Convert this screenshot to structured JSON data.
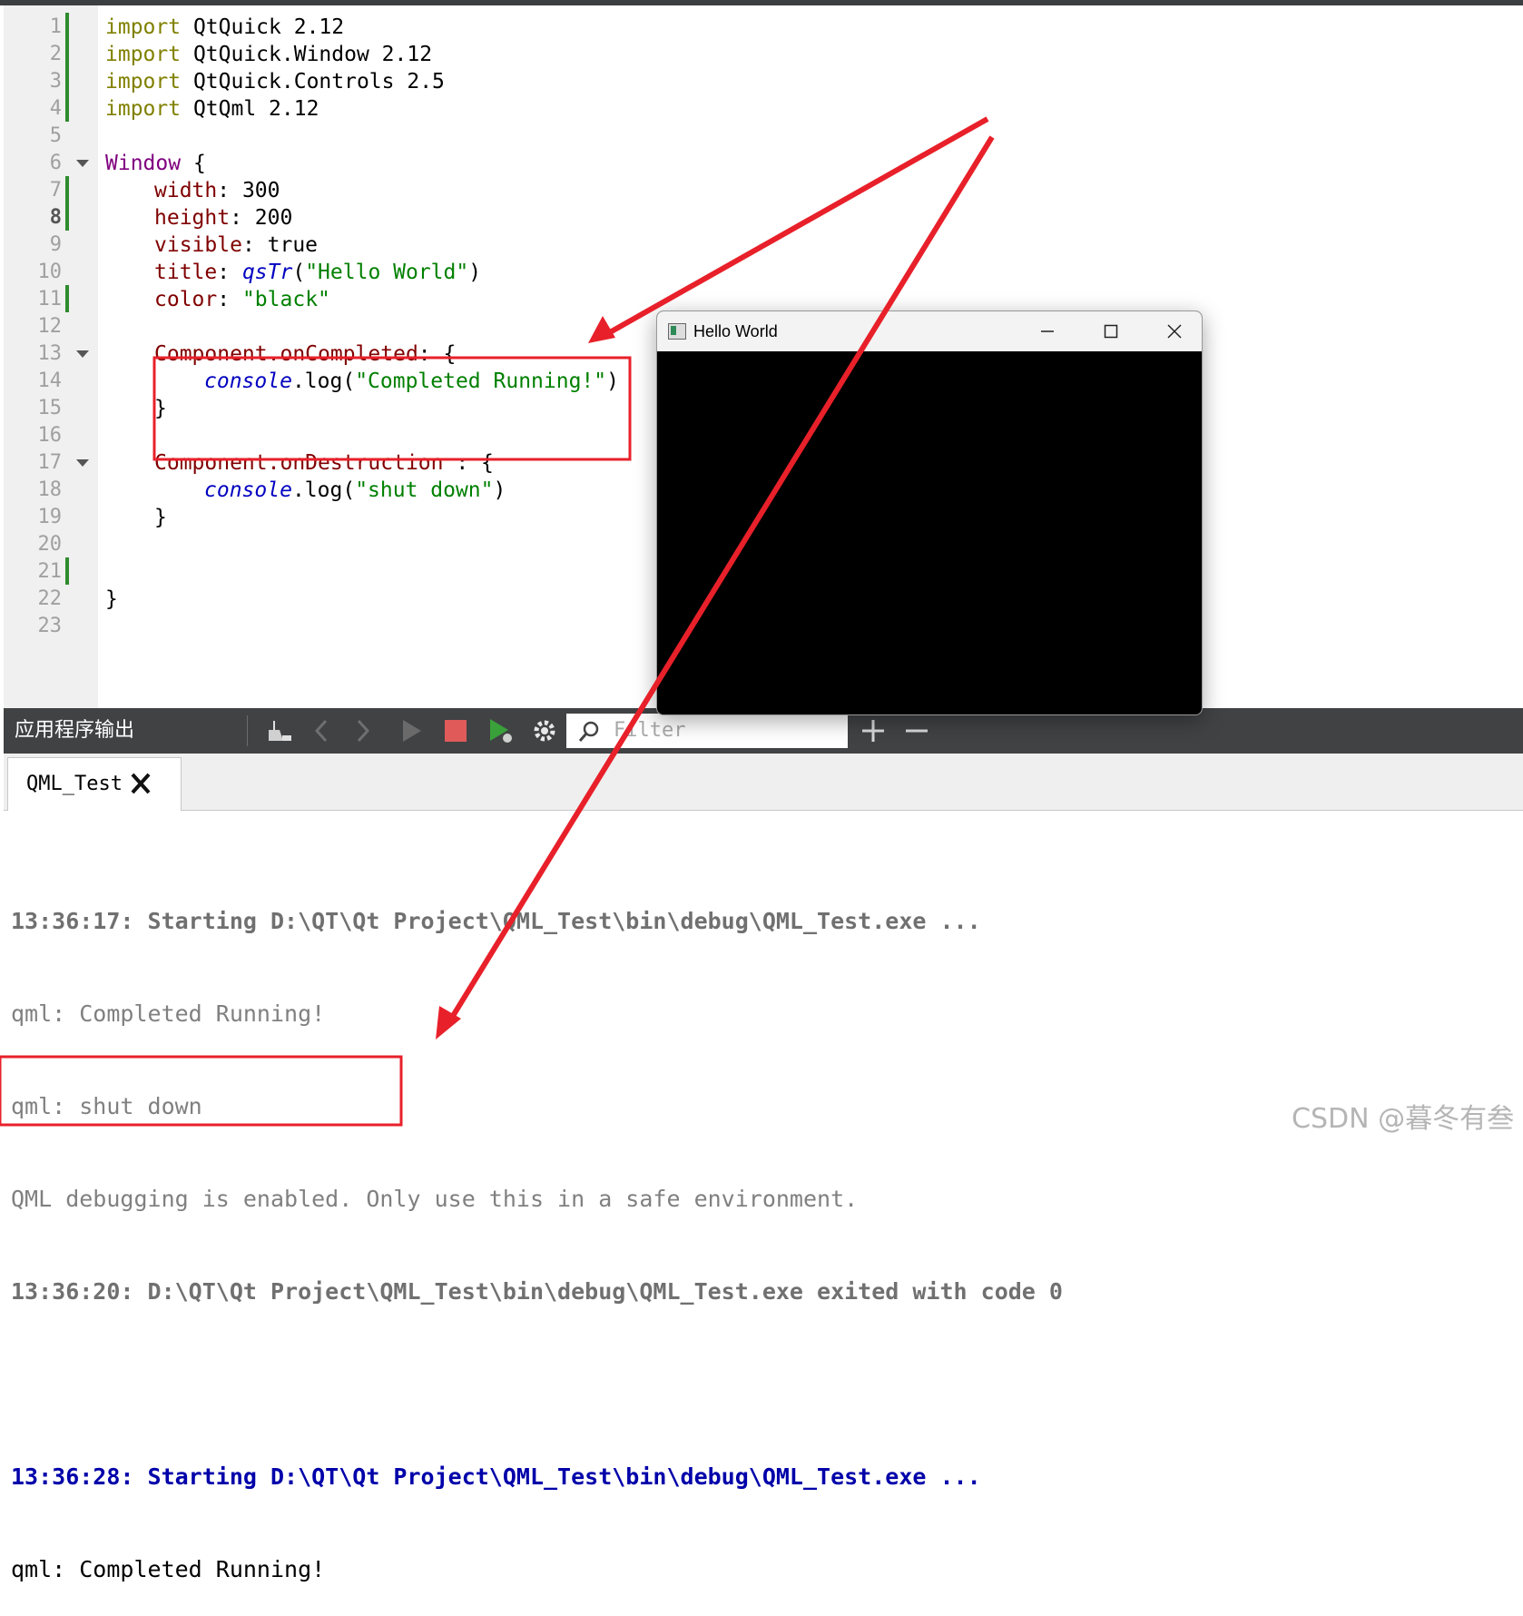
{
  "editor": {
    "line_numbers": [
      "1",
      "2",
      "3",
      "4",
      "5",
      "6",
      "7",
      "8",
      "9",
      "10",
      "11",
      "12",
      "13",
      "14",
      "15",
      "16",
      "17",
      "18",
      "19",
      "20",
      "21",
      "22",
      "23"
    ],
    "current_line": "8",
    "lines": {
      "l1": {
        "kw": "import",
        "rest": " QtQuick 2.12"
      },
      "l2": {
        "kw": "import",
        "rest": " QtQuick.Window 2.12"
      },
      "l3": {
        "kw": "import",
        "rest": " QtQuick.Controls 2.5"
      },
      "l4": {
        "kw": "import",
        "rest": " QtQml 2.12"
      },
      "l6": {
        "type": "Window",
        "rest": " {"
      },
      "l7": {
        "prop": "width",
        "rest": ": 300"
      },
      "l8": {
        "prop": "height",
        "rest": ": 200"
      },
      "l9": {
        "prop": "visible",
        "rest": ": true"
      },
      "l10": {
        "prop": "title",
        "mid": ": ",
        "fn": "qsTr",
        "open": "(",
        "str": "\"Hello World\"",
        "close": ")"
      },
      "l11": {
        "prop": "color",
        "mid": ": ",
        "str": "\"black\""
      },
      "l13": {
        "prop": "Component.onCompleted",
        "rest": ": {"
      },
      "l14": {
        "obj": "console",
        "rest": ".log(",
        "str": "\"Completed Running!\"",
        "close": ")"
      },
      "l15": {
        "rest": "}"
      },
      "l17": {
        "prop": "Component.onDestruction",
        "rest": " : {"
      },
      "l18": {
        "obj": "console",
        "rest": ".log(",
        "str": "\"shut down\"",
        "close": ")"
      },
      "l19": {
        "rest": "}"
      },
      "l22": {
        "rest": "}"
      }
    }
  },
  "output_pane": {
    "title": "应用程序输出",
    "filter_placeholder": "Filter",
    "tab_label": "QML_Test",
    "log": [
      "13:36:17: Starting D:\\QT\\Qt Project\\QML_Test\\bin\\debug\\QML_Test.exe ...",
      "qml: Completed Running!",
      "qml: shut down",
      "QML debugging is enabled. Only use this in a safe environment.",
      "13:36:20: D:\\QT\\Qt Project\\QML_Test\\bin\\debug\\QML_Test.exe exited with code 0",
      "",
      "13:36:28: Starting D:\\QT\\Qt Project\\QML_Test\\bin\\debug\\QML_Test.exe ...",
      "qml: Completed Running!"
    ]
  },
  "app_window": {
    "title": "Hello World"
  },
  "watermark": "CSDN @暮冬有叁",
  "colors": {
    "annotation": "#e8202a",
    "keyword": "#808000",
    "string": "#008000",
    "diff_marker": "#2e8b2e"
  }
}
